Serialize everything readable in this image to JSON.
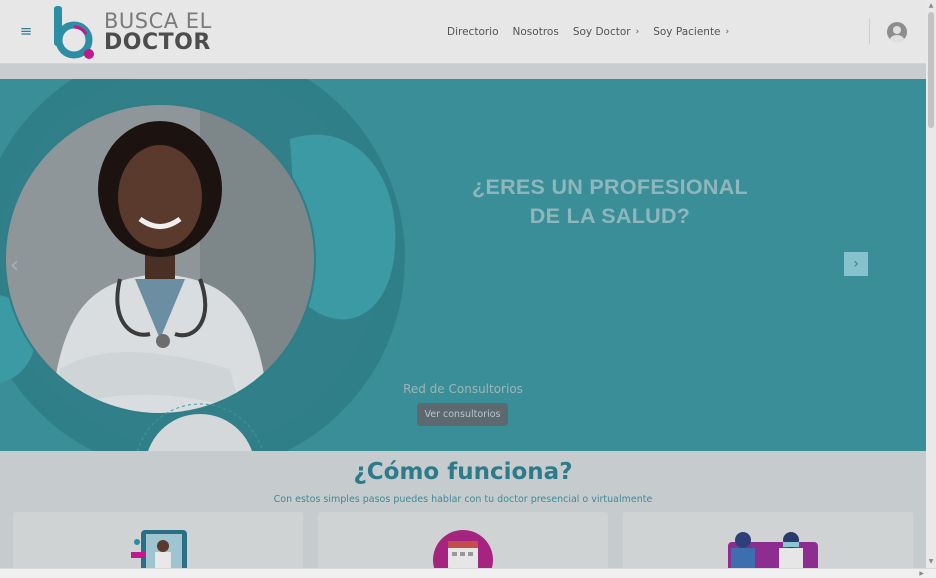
{
  "brand": {
    "line1": "BUSCA EL",
    "line2": "DOCTOR"
  },
  "header": {
    "menu_icon": "hamburger-icon",
    "nav": [
      {
        "label": "Directorio",
        "has_caret": false
      },
      {
        "label": "Nosotros",
        "has_caret": false
      },
      {
        "label": "Soy Doctor",
        "has_caret": true
      },
      {
        "label": "Soy Paciente",
        "has_caret": true
      }
    ],
    "caret_glyph": "›",
    "user_icon": "user-avatar-icon"
  },
  "hero": {
    "title_line1": "¿ERES UN PROFESIONAL",
    "title_line2": "DE LA SALUD?",
    "subtitle": "Red de Consultorios",
    "button_label": "Ver consultorios",
    "prev_glyph": "‹",
    "next_glyph": "›"
  },
  "how": {
    "title": "¿Cómo funciona?",
    "subtitle": "Con estos simples pasos puedes hablar con tu doctor presencial o virtualmente"
  },
  "colors": {
    "teal": "#3a8e98",
    "brand_teal": "#2d7a8a",
    "accent_magenta": "#c2188b"
  }
}
